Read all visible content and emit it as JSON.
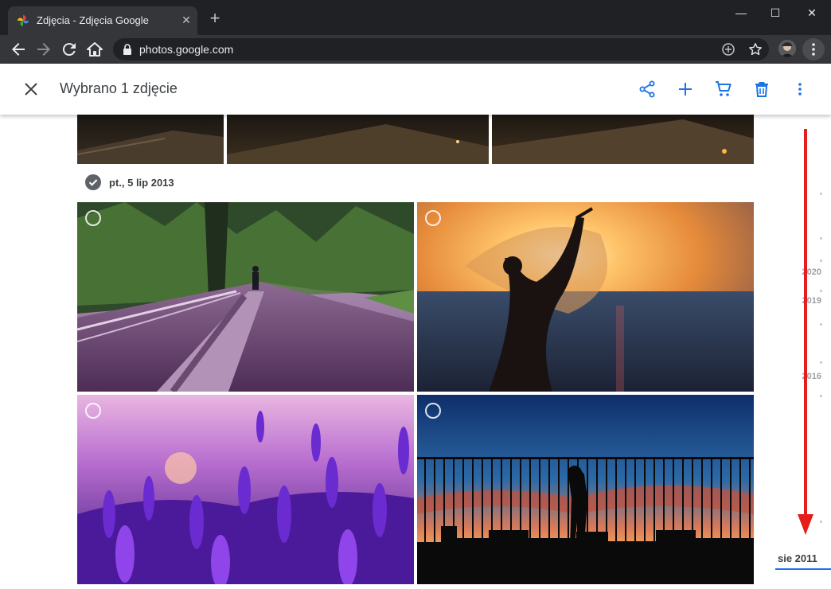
{
  "browser": {
    "tab_title": "Zdjęcia - Zdjęcia Google",
    "url": "photos.google.com",
    "colors": {
      "frame": "#202124",
      "toolbar": "#35363a"
    }
  },
  "header": {
    "title": "Wybrano 1 zdjęcie",
    "icons": [
      "close-icon",
      "share-icon",
      "add-icon",
      "cart-icon",
      "delete-icon",
      "more-vert-icon"
    ],
    "accent": "#1a73e8"
  },
  "content": {
    "date_label": "pt., 5 lip 2013",
    "photos": [
      {
        "subject": "person walking on wet road by forest"
      },
      {
        "subject": "woman silhouette with scarf at sunset"
      },
      {
        "subject": "lavender field"
      },
      {
        "subject": "silhouette behind fence at sunset"
      }
    ]
  },
  "scrubber": {
    "years": [
      "2020",
      "2019",
      "2016"
    ],
    "current": "sie 2011"
  }
}
